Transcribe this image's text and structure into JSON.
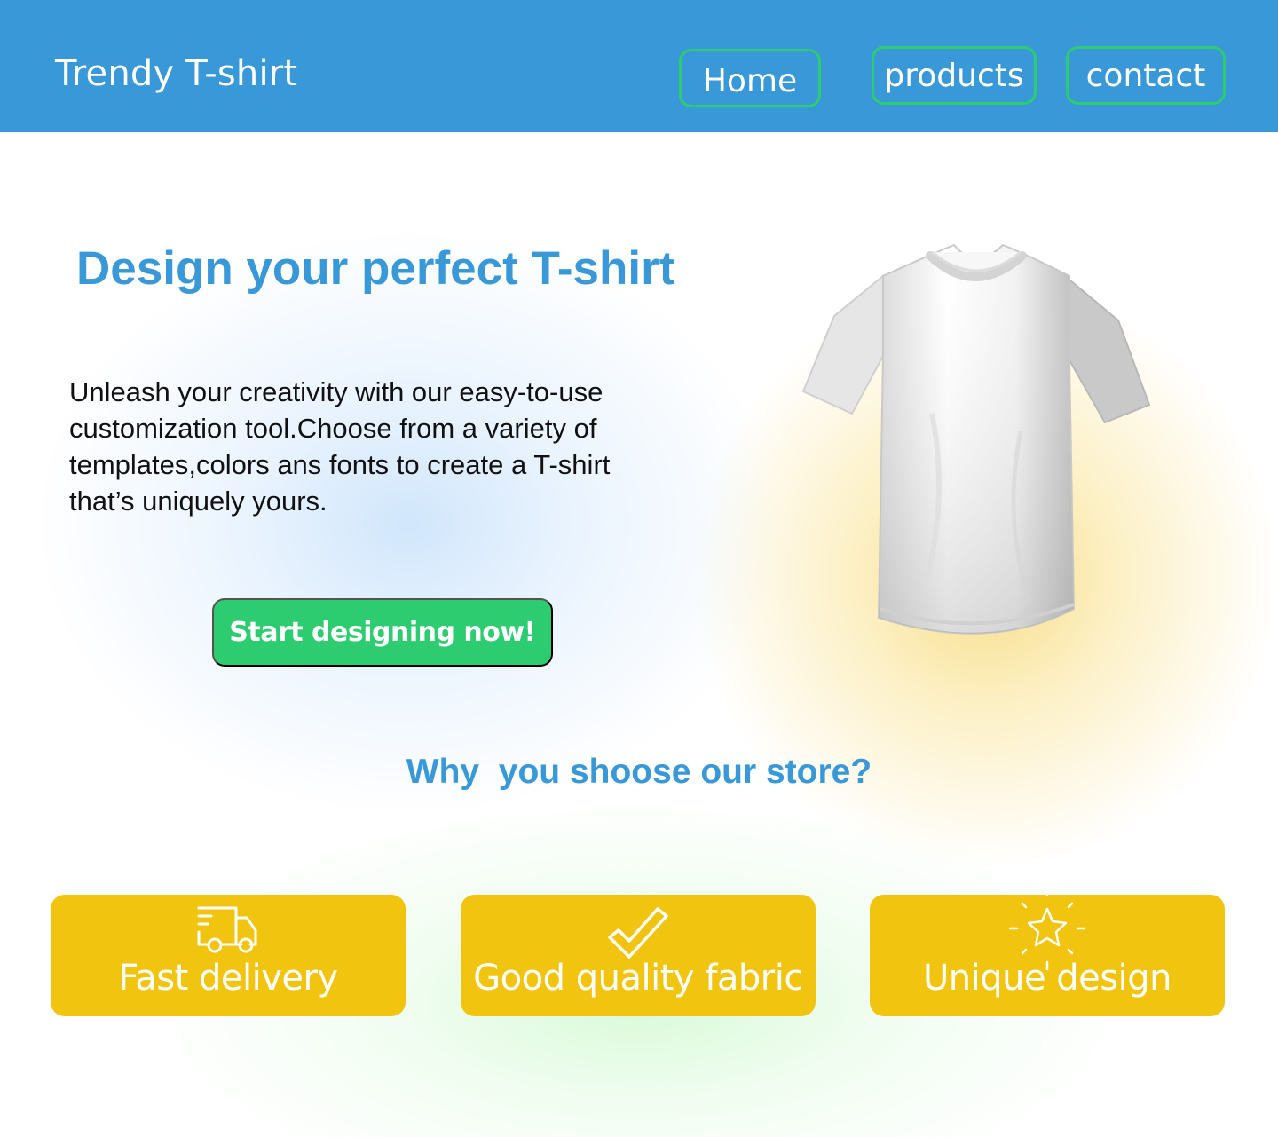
{
  "header": {
    "brand": "Trendy T-shirt",
    "nav": {
      "home": "Home",
      "products": "products",
      "contact": "contact"
    }
  },
  "hero": {
    "title": "Design your perfect T-shirt",
    "description": "Unleash your creativity with our easy-to-use\ncustomization tool.Choose from a variety of\ntemplates,colors ans fonts to create a T-shirt\nthat’s uniquely  yours.",
    "cta_label": "Start designing now!",
    "image_icon": "tshirt-icon"
  },
  "why": {
    "title": "Why  you shoose our store?",
    "features": [
      {
        "label": "Fast delivery",
        "icon": "delivery-truck-icon"
      },
      {
        "label": "Good quality fabric",
        "icon": "checkmark-icon"
      },
      {
        "label": "Unique design",
        "icon": "sparkle-star-icon"
      }
    ]
  },
  "colors": {
    "header_bg": "#3898d8",
    "accent_green": "#2ecc71",
    "card_yellow": "#f1c40f",
    "title_blue": "#3898d8"
  }
}
